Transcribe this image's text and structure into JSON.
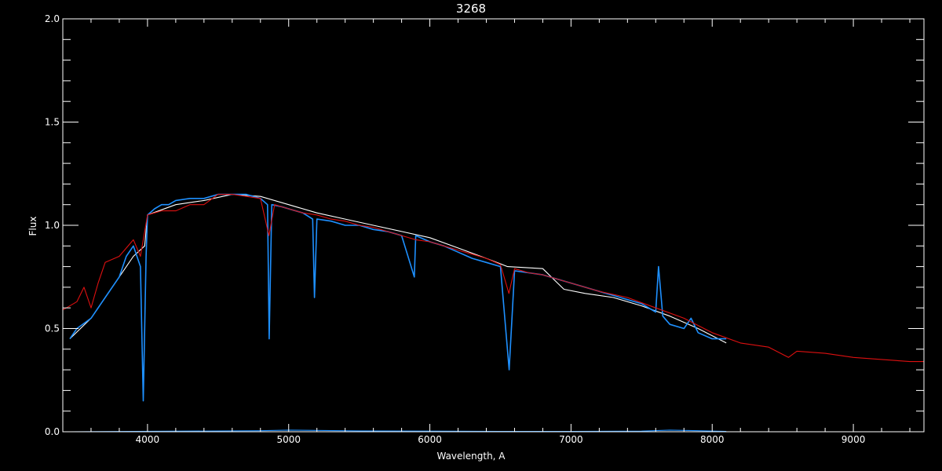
{
  "chart_data": {
    "type": "line",
    "title": "3268",
    "xlabel": "Wavelength, A",
    "ylabel": "Flux",
    "xlim": [
      3400,
      9500
    ],
    "ylim": [
      0.0,
      2.0
    ],
    "x_ticks": [
      4000,
      5000,
      6000,
      7000,
      8000,
      9000
    ],
    "x_tick_labels": [
      "4000",
      "5000",
      "6000",
      "7000",
      "8000",
      "9000"
    ],
    "y_ticks": [
      0.0,
      0.5,
      1.0,
      1.5,
      2.0
    ],
    "y_tick_labels": [
      "0.0",
      "0.5",
      "1.0",
      "1.5",
      "2.0"
    ],
    "grid": false,
    "colors": {
      "background": "#000000",
      "axes": "#ffffff",
      "observed_raw": "#ffffff",
      "observed": "#1e90ff",
      "model": "#dd1010"
    },
    "series": [
      {
        "name": "",
        "color": "#ffffff",
        "x": [
          3450,
          3600,
          3800,
          3900,
          3980,
          4000,
          4200,
          4400,
          4600,
          4800,
          5000,
          5200,
          5400,
          5600,
          5800,
          6000,
          6200,
          6400,
          6550,
          6800,
          6950,
          7100,
          7300,
          7500,
          7700,
          7900,
          8100
        ],
        "y": [
          0.45,
          0.55,
          0.75,
          0.85,
          0.9,
          1.05,
          1.1,
          1.12,
          1.15,
          1.14,
          1.1,
          1.06,
          1.03,
          1.0,
          0.97,
          0.94,
          0.89,
          0.84,
          0.8,
          0.79,
          0.69,
          0.67,
          0.65,
          0.61,
          0.56,
          0.5,
          0.43
        ]
      },
      {
        "name": "",
        "color": "#1e90ff",
        "x": [
          3450,
          3500,
          3600,
          3700,
          3800,
          3850,
          3900,
          3950,
          3970,
          3990,
          4000,
          4050,
          4100,
          4150,
          4200,
          4300,
          4400,
          4500,
          4600,
          4700,
          4800,
          4850,
          4862,
          4880,
          4950,
          5000,
          5100,
          5170,
          5183,
          5200,
          5300,
          5400,
          5500,
          5600,
          5700,
          5800,
          5890,
          5900,
          6000,
          6100,
          6200,
          6300,
          6400,
          6500,
          6562,
          6600,
          6700,
          6800,
          6950,
          7000,
          7100,
          7200,
          7300,
          7400,
          7500,
          7600,
          7620,
          7650,
          7700,
          7800,
          7850,
          7900,
          8000,
          8100
        ],
        "y": [
          0.45,
          0.5,
          0.55,
          0.65,
          0.75,
          0.85,
          0.9,
          0.8,
          0.15,
          0.85,
          1.05,
          1.08,
          1.1,
          1.1,
          1.12,
          1.13,
          1.13,
          1.15,
          1.15,
          1.15,
          1.13,
          1.1,
          0.45,
          1.1,
          1.09,
          1.08,
          1.06,
          1.03,
          0.65,
          1.03,
          1.02,
          1.0,
          1.0,
          0.98,
          0.97,
          0.95,
          0.75,
          0.95,
          0.92,
          0.9,
          0.87,
          0.84,
          0.82,
          0.8,
          0.3,
          0.78,
          0.77,
          0.76,
          0.73,
          0.72,
          0.7,
          0.68,
          0.66,
          0.64,
          0.62,
          0.58,
          0.8,
          0.56,
          0.52,
          0.5,
          0.55,
          0.48,
          0.45,
          0.45
        ]
      },
      {
        "name": "",
        "color": "#dd1010",
        "x": [
          3400,
          3500,
          3550,
          3600,
          3650,
          3700,
          3800,
          3900,
          3950,
          4000,
          4100,
          4200,
          4300,
          4400,
          4500,
          4600,
          4700,
          4800,
          4860,
          4900,
          5000,
          5100,
          5200,
          5300,
          5400,
          5500,
          5600,
          5700,
          5800,
          5900,
          6000,
          6100,
          6200,
          6300,
          6400,
          6500,
          6560,
          6600,
          6700,
          6800,
          6900,
          7000,
          7200,
          7400,
          7600,
          7800,
          8000,
          8200,
          8400,
          8540,
          8600,
          8800,
          9000,
          9200,
          9400,
          9500
        ],
        "y": [
          0.59,
          0.63,
          0.7,
          0.6,
          0.72,
          0.82,
          0.85,
          0.93,
          0.85,
          1.05,
          1.07,
          1.07,
          1.1,
          1.1,
          1.15,
          1.15,
          1.14,
          1.13,
          0.95,
          1.1,
          1.08,
          1.06,
          1.05,
          1.03,
          1.02,
          1.0,
          0.99,
          0.97,
          0.95,
          0.93,
          0.92,
          0.9,
          0.88,
          0.86,
          0.84,
          0.81,
          0.67,
          0.79,
          0.77,
          0.76,
          0.74,
          0.72,
          0.68,
          0.65,
          0.6,
          0.55,
          0.48,
          0.43,
          0.41,
          0.36,
          0.39,
          0.38,
          0.36,
          0.35,
          0.34,
          0.34
        ]
      },
      {
        "name": "",
        "color": "#1e90ff",
        "x": [
          3450,
          4800,
          5000,
          5500,
          6000,
          6500,
          7000,
          7500,
          7700,
          8100
        ],
        "y": [
          0.0,
          0.005,
          0.008,
          0.004,
          0.003,
          0.002,
          0.002,
          0.003,
          0.008,
          0.002
        ]
      }
    ]
  }
}
